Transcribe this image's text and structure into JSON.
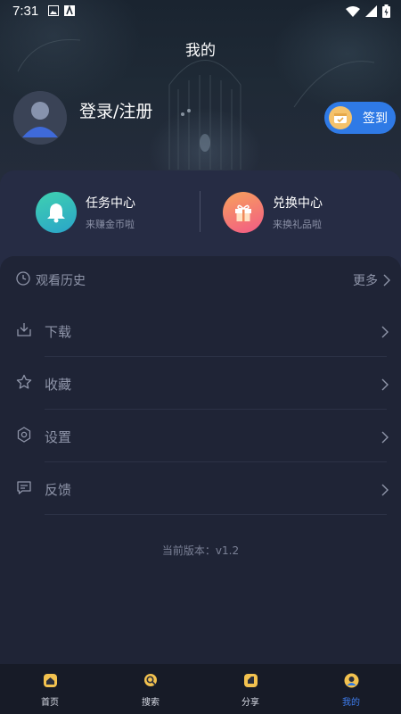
{
  "status_bar": {
    "time": "7:31"
  },
  "header": {
    "title": "我的"
  },
  "profile": {
    "login_label": "登录/注册",
    "checkin_label": "签到"
  },
  "centers": [
    {
      "title": "任务中心",
      "subtitle": "来赚金币啦",
      "icon": "bell-icon",
      "color": "#3cc6b4"
    },
    {
      "title": "兑换中心",
      "subtitle": "来换礼品啦",
      "icon": "gift-icon",
      "color": "#f47a6e"
    }
  ],
  "history": {
    "label": "观看历史",
    "more_label": "更多"
  },
  "menu": [
    {
      "label": "下载",
      "icon": "download-icon"
    },
    {
      "label": "收藏",
      "icon": "star-icon"
    },
    {
      "label": "设置",
      "icon": "settings-icon"
    },
    {
      "label": "反馈",
      "icon": "feedback-icon"
    }
  ],
  "version_text": "当前版本：v1.2",
  "tabs": [
    {
      "label": "首页",
      "icon": "home-icon",
      "active": false
    },
    {
      "label": "搜索",
      "icon": "search-icon",
      "active": false
    },
    {
      "label": "分享",
      "icon": "share-icon",
      "active": false
    },
    {
      "label": "我的",
      "icon": "profile-icon",
      "active": true
    }
  ],
  "colors": {
    "accent": "#2f7ae6",
    "tab_active": "#3f7ef0",
    "panel": "#262c44",
    "background": "#1c2030"
  }
}
